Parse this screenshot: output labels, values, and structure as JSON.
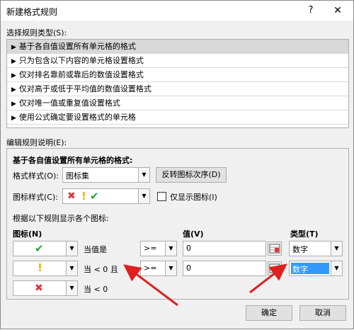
{
  "window": {
    "title": "新建格式规则",
    "help_label": "?",
    "close_label": "✕"
  },
  "rule_type_section": {
    "label": "选择规则类型(S):"
  },
  "rule_types": [
    {
      "label": "基于各自值设置所有单元格的格式",
      "selected": true
    },
    {
      "label": "只为包含以下内容的单元格设置格式",
      "selected": false
    },
    {
      "label": "仅对排名靠前或靠后的数值设置格式",
      "selected": false
    },
    {
      "label": "仅对高于或低于平均值的数值设置格式",
      "selected": false
    },
    {
      "label": "仅对唯一值或重复值设置格式",
      "selected": false
    },
    {
      "label": "使用公式确定要设置格式的单元格",
      "selected": false
    }
  ],
  "edit_section": {
    "label": "编辑规则说明(E):",
    "header": "基于各自值设置所有单元格的格式:",
    "format_style_label": "格式样式(O):",
    "format_style_value": "图标集",
    "reverse_button": "反转图标次序(D)",
    "icon_style_label": "图标样式(C):",
    "show_icon_only_label": "仅显示图标(I)",
    "rules_caption": "根据以下规则显示各个图标:",
    "col_icon": "图标(N)",
    "col_value": "值(V)",
    "col_type": "类型(T)"
  },
  "icon_rules": [
    {
      "icon": "check-icon",
      "condition": "当值是",
      "operator": ">=",
      "value": "0",
      "type": "数字"
    },
    {
      "icon": "exclamation-icon",
      "condition": "当 < 0 且",
      "operator": ">=",
      "value": "0",
      "type": "数字"
    },
    {
      "icon": "cross-icon",
      "condition": "当 < 0"
    }
  ],
  "footer": {
    "ok_label": "确定",
    "cancel_label": "取消"
  },
  "colors": {
    "check": "#2e9e3a",
    "exclamation": "#f0b400",
    "cross": "#d9363e",
    "arrow": "#e02020",
    "type_selected": "#3399ff"
  }
}
